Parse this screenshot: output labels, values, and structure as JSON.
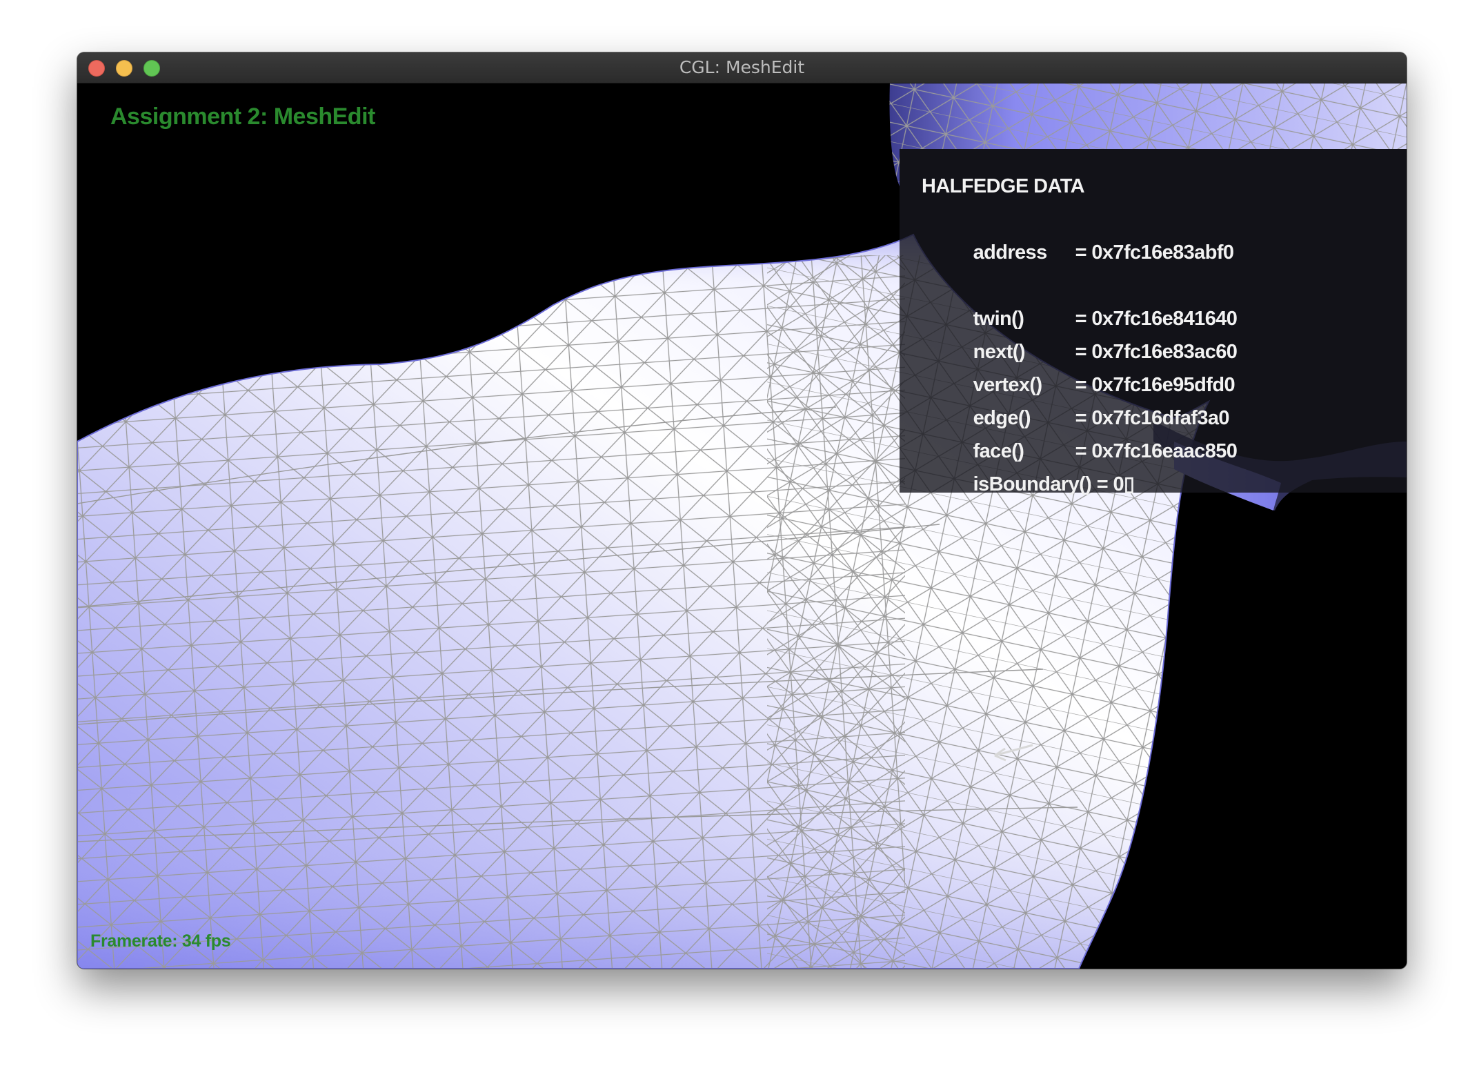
{
  "window": {
    "title": "CGL: MeshEdit"
  },
  "app": {
    "title": "Assignment 2: MeshEdit",
    "framerate": "Framerate: 34 fps"
  },
  "halfedge_panel": {
    "heading": "HALFEDGE DATA",
    "address_key": "address",
    "address_val": "= 0x7fc16e83abf0",
    "twin_key": "twin()",
    "twin_val": "= 0x7fc16e841640",
    "next_key": "next()",
    "next_val": "= 0x7fc16e83ac60",
    "vertex_key": "vertex()",
    "vertex_val": "= 0x7fc16e95dfd0",
    "edge_key": "edge()",
    "edge_val": "= 0x7fc16dfaf3a0",
    "face_key": "face()",
    "face_val": "= 0x7fc16eaac850",
    "boundary_key": "isBoundary()",
    "boundary_val": "= 0▯"
  },
  "colors": {
    "mesh_light": "#f4f4ff",
    "mesh_dark": "#8f8fef",
    "wire": "#9a9a9a",
    "label_green": "#2a8a2e",
    "background": "#000000"
  }
}
